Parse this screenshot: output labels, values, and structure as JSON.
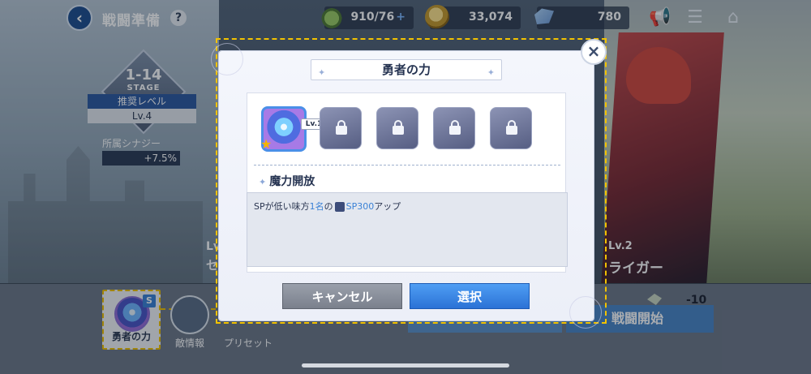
{
  "header": {
    "title": "戦闘準備",
    "back_icon": "chevron-left-icon",
    "help_icon": "question-icon"
  },
  "resources": {
    "stamina": "910/76",
    "coins": "33,074",
    "gems": "780"
  },
  "stage": {
    "number": "1-14",
    "label": "STAGE",
    "recommended_label": "推奨レベル",
    "recommended_value": "Lv.4",
    "affiliation_label": "所属シナジー",
    "affiliation_value": "+7.5%"
  },
  "characters": {
    "left_partial": "Lv",
    "left_name_partial": "セ",
    "right_level": "Lv.2",
    "right_name": "ライガー"
  },
  "dialog": {
    "title": "勇者の力",
    "level_tag": "Lv.1",
    "section_title": "魔力開放",
    "description_prefix": "SPが低い味方",
    "description_count": "1名",
    "description_mid": "の",
    "description_sp": "SP300",
    "description_suffix": "アップ",
    "cancel_label": "キャンセル",
    "select_label": "選択"
  },
  "bottom": {
    "skill_label": "勇者の力",
    "enemy_label": "敵情報",
    "preset_label": "プリセット",
    "cost": "-10",
    "start_label": "戦闘開始"
  },
  "colors": {
    "accent": "#2b72d6",
    "highlight": "#f2c200"
  }
}
